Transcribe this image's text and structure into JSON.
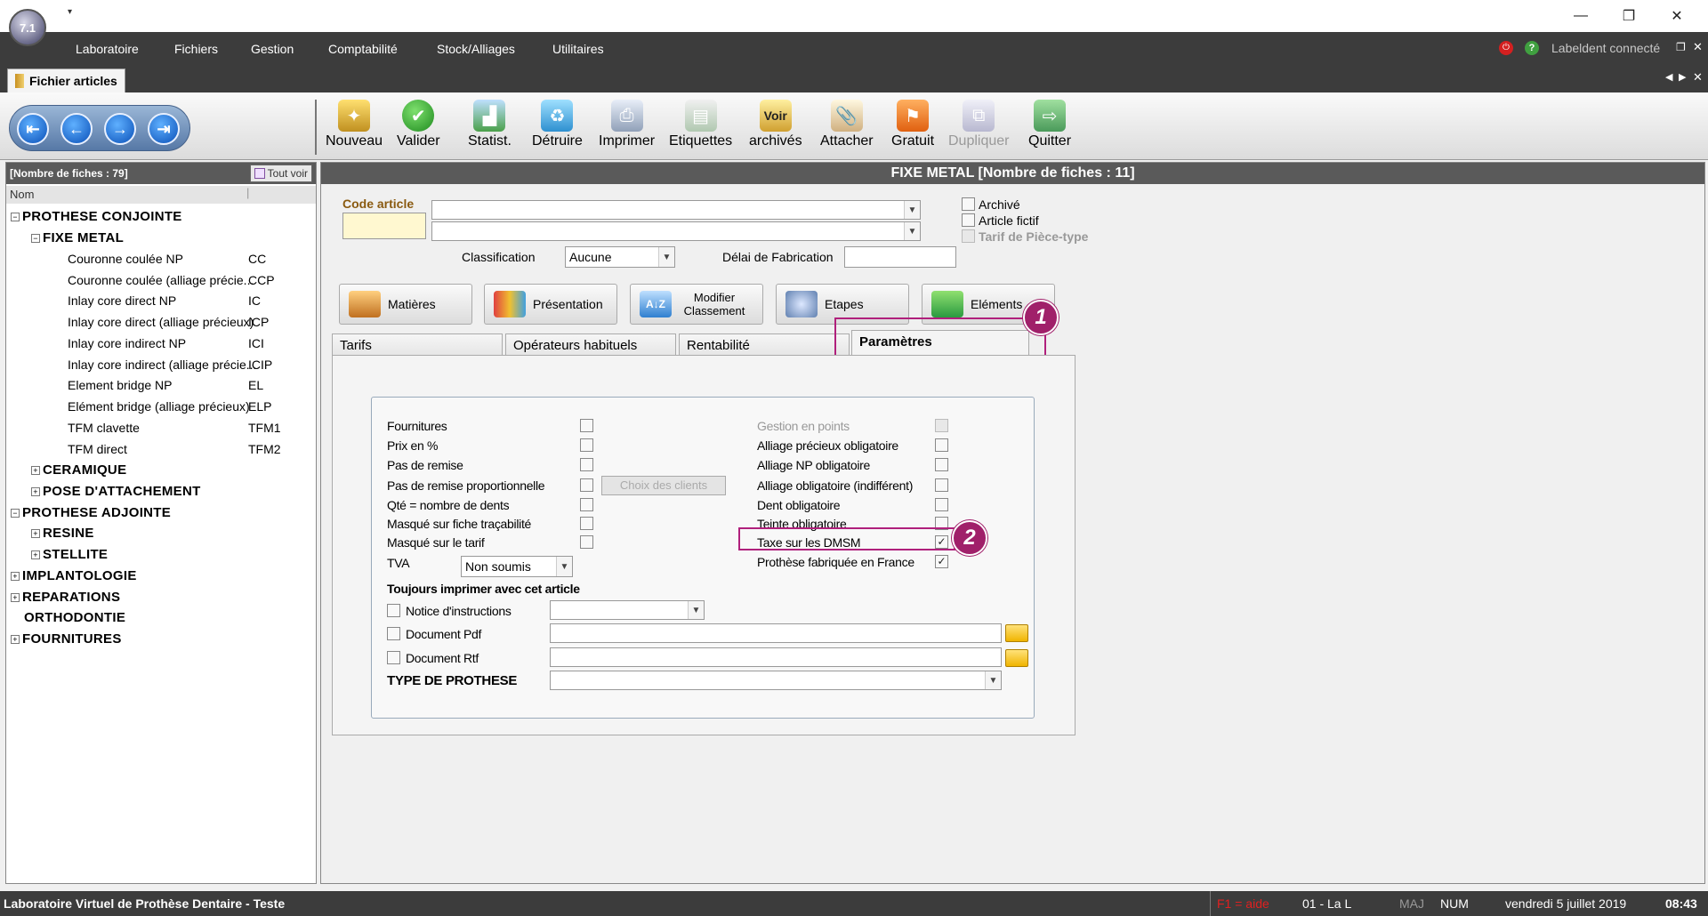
{
  "app": {
    "logo_text": "7.1",
    "window_buttons": {
      "minimize": "—",
      "restore": "❐",
      "close": "✕"
    }
  },
  "menu": [
    "Laboratoire",
    "Fichiers",
    "Gestion",
    "Comptabilité",
    "Stock/Alliages",
    "Utilitaires"
  ],
  "connection": "Labeldent connecté",
  "doc_tab": "Fichier articles",
  "toolbar": {
    "nav": [
      "first-icon",
      "prev-icon",
      "next-icon",
      "last-icon"
    ],
    "buttons": [
      {
        "label": "Nouveau",
        "icon": "magic-wand-icon",
        "enabled": true
      },
      {
        "label": "Valider",
        "icon": "check-icon",
        "enabled": true
      },
      {
        "label": "Statist.",
        "icon": "chart-icon",
        "enabled": true
      },
      {
        "label": "Détruire",
        "icon": "recycle-icon",
        "enabled": true
      },
      {
        "label": "Imprimer",
        "icon": "printer-icon",
        "enabled": true
      },
      {
        "label": "Etiquettes",
        "icon": "labels-icon",
        "enabled": true
      },
      {
        "label": "archivés",
        "icon": "archive-icon",
        "overlay": "Voir",
        "enabled": true
      },
      {
        "label": "Attacher",
        "icon": "attach-icon",
        "enabled": true
      },
      {
        "label": "Gratuit",
        "icon": "flag-icon",
        "enabled": true
      },
      {
        "label": "Dupliquer",
        "icon": "duplicate-icon",
        "enabled": false
      },
      {
        "label": "Quitter",
        "icon": "exit-door-icon",
        "enabled": true
      }
    ]
  },
  "left": {
    "header": "[Nombre de fiches : 79]",
    "tout_voir": "Tout voir",
    "col_nom": "Nom",
    "tree": [
      {
        "label": "PROTHESE CONJOINTE",
        "kind": "cat",
        "level": 0,
        "toggle": "−"
      },
      {
        "label": "FIXE METAL",
        "kind": "cat",
        "level": 1,
        "toggle": "−"
      },
      {
        "label": "Couronne coulée NP",
        "code": "CC",
        "kind": "item"
      },
      {
        "label": "Couronne coulée (alliage précie...",
        "code": "CCP",
        "kind": "item"
      },
      {
        "label": "Inlay core direct NP",
        "code": "IC",
        "kind": "item"
      },
      {
        "label": "Inlay core direct (alliage précieux)",
        "code": "ICP",
        "kind": "item"
      },
      {
        "label": "Inlay core indirect NP",
        "code": "ICI",
        "kind": "item"
      },
      {
        "label": "Inlay core indirect (alliage précie...",
        "code": "ICIP",
        "kind": "item"
      },
      {
        "label": "Element bridge NP",
        "code": "EL",
        "kind": "item"
      },
      {
        "label": "Elément bridge (alliage précieux)",
        "code": "ELP",
        "kind": "item"
      },
      {
        "label": "TFM clavette",
        "code": "TFM1",
        "kind": "item"
      },
      {
        "label": "TFM direct",
        "code": "TFM2",
        "kind": "item"
      },
      {
        "label": "CERAMIQUE",
        "kind": "cat",
        "level": 1,
        "toggle": "+"
      },
      {
        "label": "POSE D'ATTACHEMENT",
        "kind": "cat",
        "level": 1,
        "toggle": "+"
      },
      {
        "label": "PROTHESE ADJOINTE",
        "kind": "cat",
        "level": 0,
        "toggle": "−"
      },
      {
        "label": "RESINE",
        "kind": "cat",
        "level": 1,
        "toggle": "+"
      },
      {
        "label": "STELLITE",
        "kind": "cat",
        "level": 1,
        "toggle": "+"
      },
      {
        "label": "IMPLANTOLOGIE",
        "kind": "cat",
        "level": 0,
        "toggle": "+"
      },
      {
        "label": "REPARATIONS",
        "kind": "cat",
        "level": 0,
        "toggle": "+"
      },
      {
        "label": "ORTHODONTIE",
        "kind": "cat",
        "level": 0,
        "toggle": ""
      },
      {
        "label": "FOURNITURES",
        "kind": "cat",
        "level": 0,
        "toggle": "+"
      }
    ]
  },
  "right": {
    "header": "FIXE METAL [Nombre de fiches : 11]",
    "code_article_label": "Code article",
    "classification_label": "Classification",
    "classification_value": "Aucune",
    "delai_label": "Délai de Fabrication",
    "flags": [
      {
        "label": "Archivé",
        "checked": false,
        "enabled": true
      },
      {
        "label": "Article fictif",
        "checked": false,
        "enabled": true
      },
      {
        "label": "Tarif de Pièce-type",
        "checked": false,
        "enabled": false
      }
    ],
    "big_buttons": [
      {
        "label": "Matières",
        "icon": "materials-icon"
      },
      {
        "label": "Présentation",
        "icon": "presentation-icon"
      },
      {
        "label": "Modifier Classement",
        "icon": "sort-az-icon"
      },
      {
        "label": "Etapes",
        "icon": "steps-gear-icon"
      },
      {
        "label": "Eléments",
        "icon": "puzzle-icon"
      }
    ],
    "tabs": [
      "Tarifs",
      "Opérateurs habituels",
      "Rentabilité",
      "Paramètres"
    ],
    "active_tab": "Paramètres",
    "params_left": [
      {
        "label": "Fournitures",
        "checked": false
      },
      {
        "label": "Prix en %",
        "checked": false
      },
      {
        "label": "Pas de remise",
        "checked": false
      },
      {
        "label": "Pas de remise proportionnelle",
        "checked": false
      },
      {
        "label": "Qté = nombre de dents",
        "checked": false
      },
      {
        "label": "Masqué sur fiche traçabilité",
        "checked": false
      },
      {
        "label": "Masqué sur le tarif",
        "checked": false
      }
    ],
    "choix_clients": "Choix des clients",
    "params_right": [
      {
        "label": "Gestion en points",
        "checked": false,
        "enabled": false
      },
      {
        "label": "Alliage précieux obligatoire",
        "checked": false,
        "enabled": true
      },
      {
        "label": "Alliage NP obligatoire",
        "checked": false,
        "enabled": true
      },
      {
        "label": "Alliage obligatoire (indifférent)",
        "checked": false,
        "enabled": true
      },
      {
        "label": "Dent obligatoire",
        "checked": false,
        "enabled": true
      },
      {
        "label": "Teinte obligatoire",
        "checked": false,
        "enabled": true
      },
      {
        "label": "Taxe sur les DMSM",
        "checked": true,
        "enabled": true
      },
      {
        "label": "Prothèse fabriquée en France",
        "checked": true,
        "enabled": true
      }
    ],
    "tva_label": "TVA",
    "tva_value": "Non soumis",
    "toujours_label": "Toujours imprimer avec cet article",
    "notice_label": "Notice d'instructions",
    "pdf_label": "Document Pdf",
    "rtf_label": "Document Rtf",
    "type_prothese_label": "TYPE DE PROTHESE",
    "badges": [
      "1",
      "2"
    ]
  },
  "status": {
    "lab": "Laboratoire Virtuel de Prothèse Dentaire - Teste",
    "help": "F1 = aide",
    "code": "01 - La L",
    "maj": "MAJ",
    "num": "NUM",
    "date": "vendredi 5 juillet 2019",
    "time": "08:43"
  },
  "colors": {
    "menubar": "#3c3c3c",
    "highlight": "#b0207c",
    "badge": "#a0206a",
    "help_text": "#e02020"
  }
}
